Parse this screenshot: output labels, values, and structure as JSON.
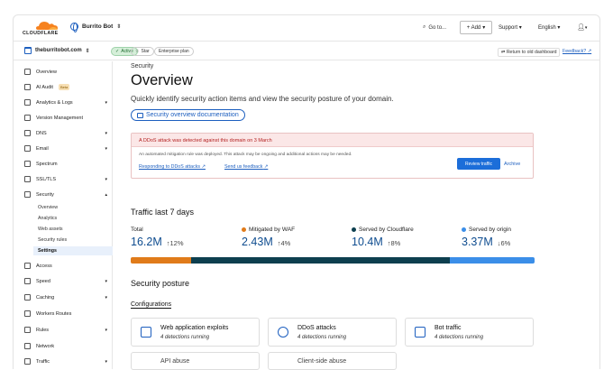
{
  "brand": {
    "logo_text": "CLOUDFLARE",
    "accent": "#f6821f",
    "link": "#1d5fbf"
  },
  "header": {
    "account": "Burrito Bot",
    "goto": "Go to...",
    "add": "+ Add",
    "support": "Support",
    "language": "English"
  },
  "zone": {
    "domain": "theburritobot.com",
    "status": "Active",
    "star": "Star",
    "plan": "Enterprise plan",
    "return_link": "Return to old dashboard",
    "feedback": "Feedback?"
  },
  "sidebar": {
    "items": [
      {
        "label": "Overview",
        "icon": "home-icon"
      },
      {
        "label": "AI Audit",
        "badge": "Beta",
        "icon": "ai-icon"
      },
      {
        "label": "Analytics & Logs",
        "icon": "chart-icon",
        "caret": true
      },
      {
        "label": "Version Management",
        "icon": "branch-icon"
      },
      {
        "label": "DNS",
        "icon": "network-icon",
        "caret": true
      },
      {
        "label": "Email",
        "icon": "mail-icon",
        "caret": true
      },
      {
        "label": "Spectrum",
        "icon": "spectrum-icon"
      },
      {
        "label": "SSL/TLS",
        "icon": "lock-icon",
        "caret": true
      },
      {
        "label": "Security",
        "icon": "shield-icon",
        "caret": true
      }
    ],
    "security_sub": [
      "Overview",
      "Analytics",
      "Web assets",
      "Security rules",
      "Settings"
    ],
    "items_after": [
      {
        "label": "Access",
        "icon": "access-icon"
      },
      {
        "label": "Speed",
        "icon": "speed-icon",
        "caret": true
      },
      {
        "label": "Caching",
        "icon": "cache-icon",
        "caret": true
      },
      {
        "label": "Workers Routes",
        "icon": "workers-icon"
      },
      {
        "label": "Rules",
        "icon": "rules-icon",
        "caret": true
      },
      {
        "label": "Network",
        "icon": "network2-icon"
      },
      {
        "label": "Traffic",
        "icon": "traffic-icon",
        "caret": true
      }
    ]
  },
  "main": {
    "eyebrow": "Security",
    "title": "Overview",
    "description": "Quickly identify security action items and view the security posture of your domain.",
    "doc_button": "Security overview documentation",
    "alert": {
      "title": "A DDoS attack was detected against this domain on 3 March",
      "body": "An automated mitigation rule was deployed. This attack may be ongoing and additional actions may be needed.",
      "link1": "Responding to DDoS attacks",
      "link2": "Send us feedback",
      "review": "Review traffic",
      "archive": "Archive"
    },
    "traffic_title": "Traffic last 7 days",
    "metrics": [
      {
        "label": "Total",
        "value": "16.2M",
        "change": "↑12%",
        "color": ""
      },
      {
        "label": "Mitigated by WAF",
        "value": "2.43M",
        "change": "↑4%",
        "color": "#e07b1a"
      },
      {
        "label": "Served by Cloudflare",
        "value": "10.4M",
        "change": "↑8%",
        "color": "#0d3f4f"
      },
      {
        "label": "Served by origin",
        "value": "3.37M",
        "change": "↓6%",
        "color": "#3b8ee8"
      }
    ],
    "bar_shares": [
      0.15,
      0.64,
      0.21
    ],
    "bar_colors": [
      "#e07b1a",
      "#0d3f4f",
      "#3b8ee8"
    ],
    "posture_title": "Security posture",
    "configurations": "Configurations",
    "cards": [
      {
        "name": "Web application exploits",
        "detail": "4 detections running",
        "icon": "firewall-icon"
      },
      {
        "name": "DDoS attacks",
        "detail": "4 detections running",
        "icon": "ddos-icon"
      },
      {
        "name": "Bot traffic",
        "detail": "4 detections running",
        "icon": "bot-icon"
      },
      {
        "name": "API abuse",
        "icon": "api-icon"
      },
      {
        "name": "Client-side abuse",
        "icon": "client-icon"
      }
    ]
  }
}
